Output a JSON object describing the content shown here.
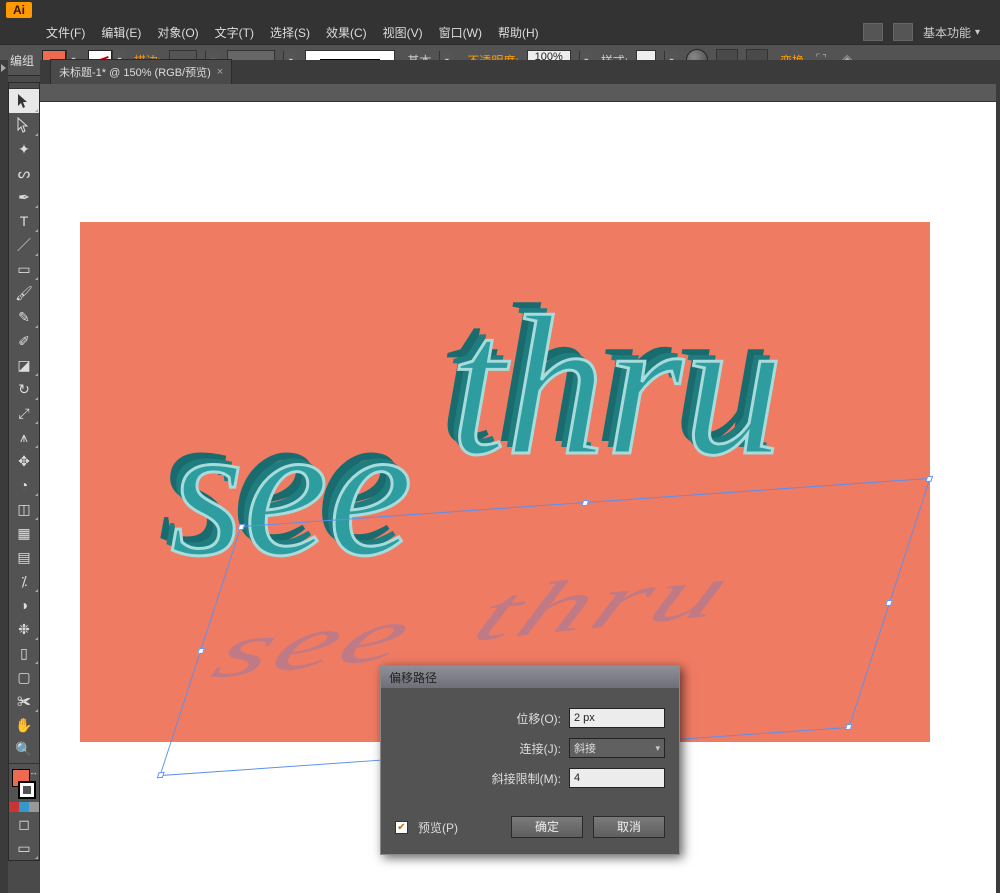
{
  "app": {
    "logo": "Ai"
  },
  "menu": {
    "items": [
      "文件(F)",
      "编辑(E)",
      "对象(O)",
      "文字(T)",
      "选择(S)",
      "效果(C)",
      "视图(V)",
      "窗口(W)",
      "帮助(H)"
    ],
    "workspace": "基本功能"
  },
  "control": {
    "group_label": "编组",
    "stroke_label": "描边:",
    "stroke_size": "",
    "brush_label": "基本",
    "opacity_label": "不透明度:",
    "opacity_value": "100%",
    "style_label": "样式:",
    "transform_label": "变换"
  },
  "doc": {
    "tab_title": "未标题-1* @ 150% (RGB/预览)"
  },
  "artwork": {
    "bg_color": "#f07b63",
    "word1": "see",
    "word2": "thru",
    "shadow1": "see",
    "shadow2": "thru"
  },
  "dialog": {
    "title": "偏移路径",
    "offset_label": "位移(O):",
    "offset_value": "2 px",
    "join_label": "连接(J):",
    "join_value": "斜接",
    "miter_label": "斜接限制(M):",
    "miter_value": "4",
    "preview_label": "预览(P)",
    "ok": "确定",
    "cancel": "取消"
  },
  "tools": [
    "selection",
    "direct-select",
    "magic-wand",
    "lasso",
    "pen",
    "type",
    "line",
    "rectangle",
    "paintbrush",
    "pencil",
    "blob",
    "eraser",
    "rotate",
    "scale",
    "width",
    "free-transform",
    "shape-builder",
    "perspective",
    "mesh",
    "gradient",
    "eyedropper",
    "blend",
    "symbol-spray",
    "graph",
    "artboard",
    "slice",
    "hand",
    "zoom"
  ]
}
